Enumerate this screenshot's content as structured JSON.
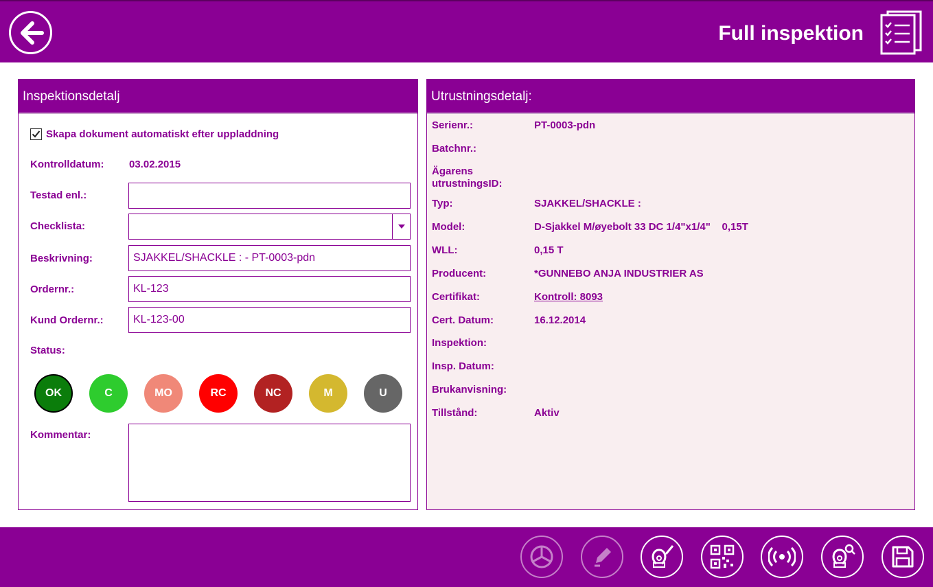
{
  "header": {
    "title": "Full inspektion"
  },
  "left_panel": {
    "title": "Inspektionsdetalj",
    "auto_doc_label": "Skapa dokument automatiskt efter uppladdning",
    "auto_doc_checked": true,
    "date_label": "Kontrolldatum:",
    "date_value": "03.02.2015",
    "tested_label": "Testad enl.:",
    "tested_value": "",
    "checklist_label": "Checklista:",
    "checklist_value": "",
    "description_label": "Beskrivning:",
    "description_value": "SJAKKEL/SHACKLE : - PT-0003-pdn",
    "order_label": "Ordernr.:",
    "order_value": "KL-123",
    "customer_order_label": "Kund Ordernr.:",
    "customer_order_value": "KL-123-00",
    "status_label": "Status:",
    "statuses": [
      {
        "label": "OK",
        "color": "#0b7d0b",
        "selected": true
      },
      {
        "label": "C",
        "color": "#2ecc2e",
        "selected": false
      },
      {
        "label": "MO",
        "color": "#f08878",
        "selected": false
      },
      {
        "label": "RC",
        "color": "#ff0000",
        "selected": false
      },
      {
        "label": "NC",
        "color": "#b22222",
        "selected": false
      },
      {
        "label": "M",
        "color": "#d4b82f",
        "selected": false
      },
      {
        "label": "U",
        "color": "#666666",
        "selected": false
      }
    ],
    "comment_label": "Kommentar:",
    "comment_value": ""
  },
  "right_panel": {
    "title": "Utrustningsdetalj:",
    "rows": [
      {
        "label": "Serienr.:",
        "value": "PT-0003-pdn"
      },
      {
        "label": "Batchnr.:",
        "value": ""
      },
      {
        "label": "Ägarens utrustningsID:",
        "value": ""
      },
      {
        "label": "Typ:",
        "value": "SJAKKEL/SHACKLE :"
      },
      {
        "label": "Model:",
        "value": "D-Sjakkel M/øyebolt 33 DC 1/4\"x1/4\"    0,15T"
      },
      {
        "label": "WLL:",
        "value": "0,15 T"
      },
      {
        "label": "Producent:",
        "value": "*GUNNEBO ANJA INDUSTRIER AS"
      },
      {
        "label": "Certifikat:",
        "value": "Kontroll: 8093"
      },
      {
        "label": "Cert. Datum:",
        "value": "16.12.2014"
      },
      {
        "label": "Inspektion:",
        "value": ""
      },
      {
        "label": "Insp. Datum:",
        "value": ""
      },
      {
        "label": "Brukanvisning:",
        "value": ""
      },
      {
        "label": "Tillstånd:",
        "value": "Aktiv"
      }
    ]
  },
  "footer": {
    "buttons": [
      {
        "icon": "pie-chart-icon",
        "enabled": false
      },
      {
        "icon": "pencil-icon",
        "enabled": false
      },
      {
        "icon": "edit-shackle-icon",
        "enabled": true
      },
      {
        "icon": "qr-code-icon",
        "enabled": true
      },
      {
        "icon": "rfid-icon",
        "enabled": true
      },
      {
        "icon": "search-shackle-icon",
        "enabled": true
      },
      {
        "icon": "save-icon",
        "enabled": true
      }
    ]
  },
  "colors": {
    "brand": "#8a0094",
    "panel_bg": "#f9eef0"
  }
}
